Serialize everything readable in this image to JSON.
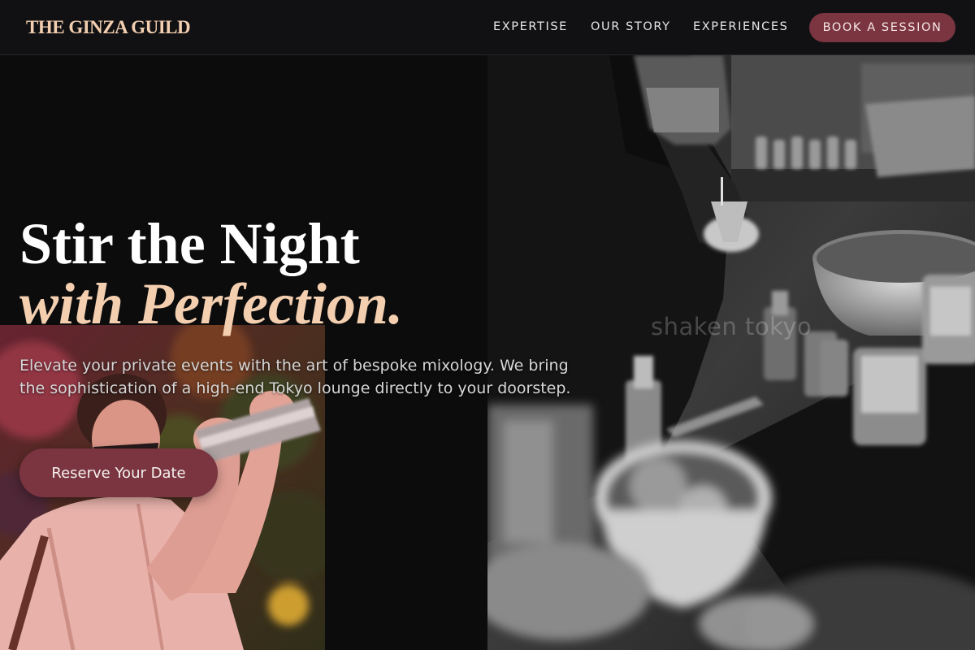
{
  "brand": {
    "logo_text": "THE GINZA GUILD"
  },
  "nav": {
    "links": [
      "EXPERTISE",
      "OUR STORY",
      "EXPERIENCES"
    ],
    "cta_label": "BOOK A SESSION"
  },
  "hero": {
    "headline_line1": "Stir the Night",
    "headline_line2": "with Perfection.",
    "subtext": "Elevate your private events with the art of bespoke mixology. We bring the sophistication of a high-end Tokyo lounge directly to your doorstep.",
    "cta_label": "Reserve Your Date"
  },
  "images": {
    "right_photo": "bartender-pouring-bar-setup-bw-photo",
    "left_photo": "bartender-shaking-cocktail-photo",
    "watermark": "shaken tokyo"
  },
  "colors": {
    "background": "#0c0c0d",
    "accent": "#7a3540",
    "peach": "#f3cfb0",
    "nav_bg": "#111113"
  }
}
